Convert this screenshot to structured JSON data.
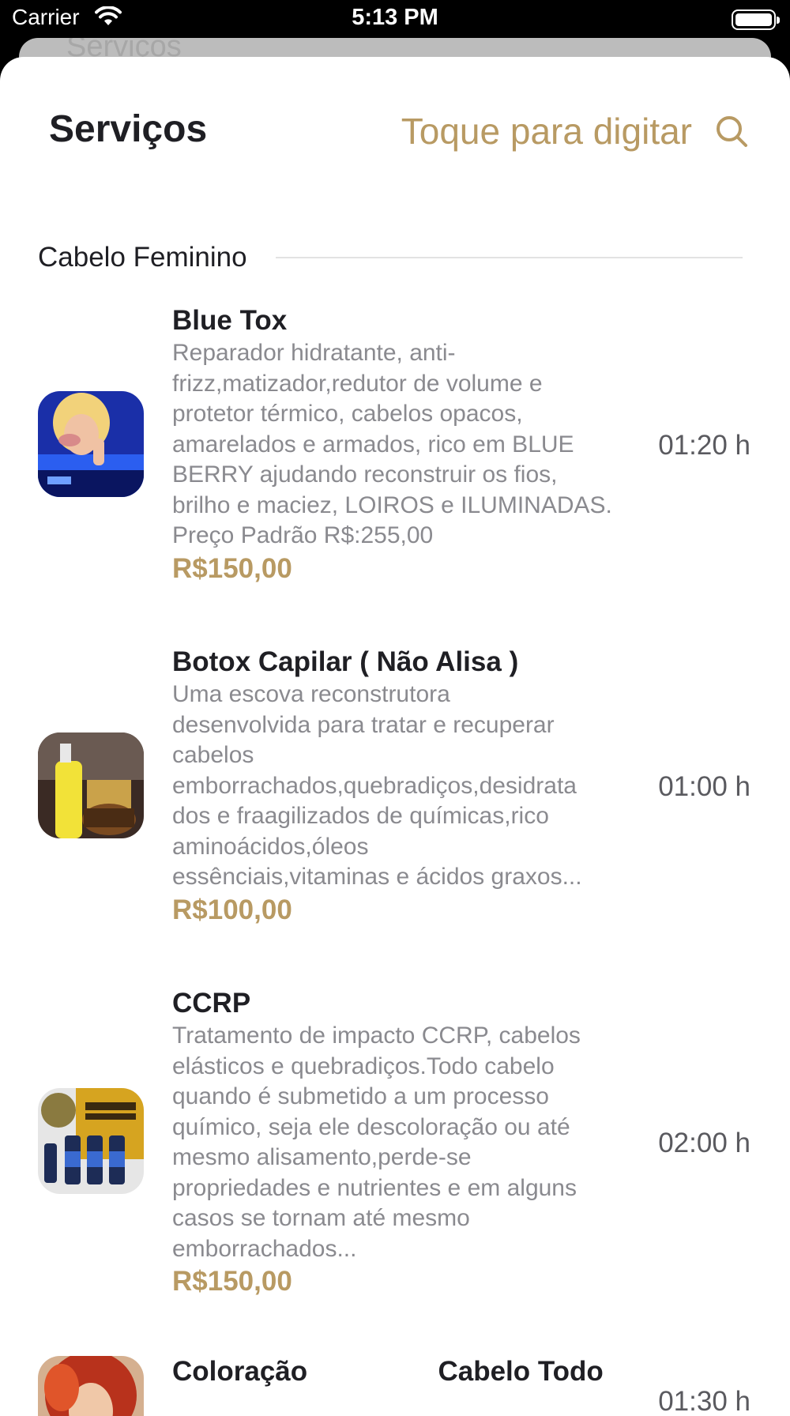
{
  "status_bar": {
    "carrier": "Carrier",
    "time": "5:13 PM"
  },
  "background_sheet": {
    "title": "Serviços"
  },
  "header": {
    "title": "Serviços",
    "search_placeholder": "Toque para digitar",
    "search_icon": "search-icon"
  },
  "section": {
    "label": "Cabelo Feminino"
  },
  "services": [
    {
      "name": "Blue Tox",
      "description_lines": [
        "Reparador hidratante, anti-",
        "frizz,matizador,redutor de volume e",
        "protetor térmico, cabelos opacos,",
        "amarelados e armados, rico em BLUE",
        "BERRY ajudando reconstruir os fios,",
        "brilho e maciez, LOIROS e ILUMINADAS.",
        "Preço Padrão R$:255,00"
      ],
      "price": "R$150,00",
      "duration": "01:20 h"
    },
    {
      "name": "Botox Capilar  ( Não Alisa )",
      "description_lines": [
        "Uma escova reconstrutora",
        "desenvolvida para tratar e recuperar",
        "cabelos",
        "emborrachados,quebradiços,desidrata",
        "dos e fraagilizados de químicas,rico",
        "aminoácidos,óleos",
        "essênciais,vitaminas e ácidos graxos..."
      ],
      "price": "R$100,00",
      "duration": "01:00 h"
    },
    {
      "name": "CCRP",
      "description_lines": [
        "Tratamento de impacto CCRP, cabelos",
        "elásticos e quebradiços.Todo cabelo",
        "quando é submetido a um processo",
        "químico, seja ele descoloração ou até",
        "mesmo alisamento,perde-se",
        "propriedades e nutrientes e em alguns",
        "casos se tornam até mesmo",
        "emborrachados..."
      ],
      "price": "R$150,00",
      "duration": "02:00 h"
    },
    {
      "name": "Coloração                 Cabelo Todo",
      "description_lines": [],
      "price": "",
      "duration": "01:30 h"
    }
  ],
  "colors": {
    "accent": "#b89a63",
    "title": "#1f1f24",
    "secondary_text": "#8a8a8f"
  }
}
